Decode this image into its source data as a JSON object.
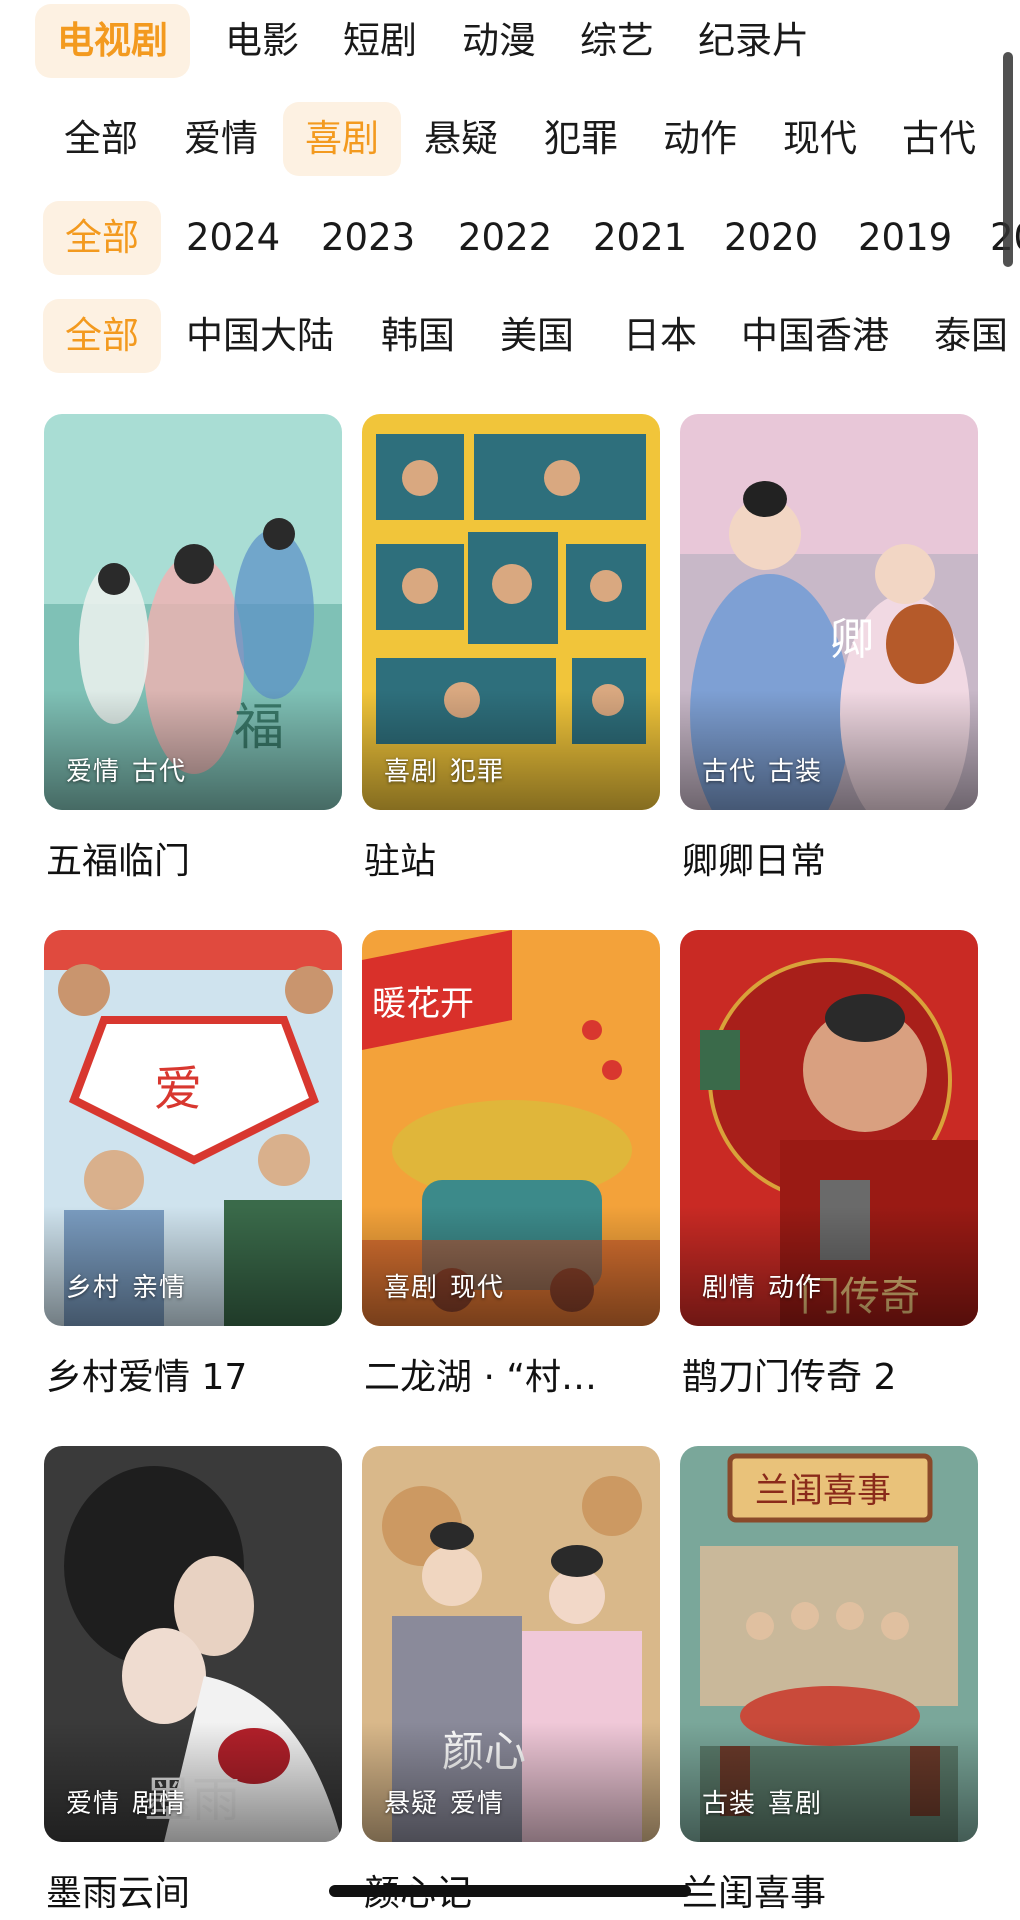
{
  "tabs": [
    "电视剧",
    "电影",
    "短剧",
    "动漫",
    "综艺",
    "纪录片"
  ],
  "genres": [
    "全部",
    "爱情",
    "喜剧",
    "悬疑",
    "犯罪",
    "动作",
    "现代",
    "古代"
  ],
  "years": [
    "全部",
    "2024",
    "2023",
    "2022",
    "2021",
    "2020",
    "2019",
    "20"
  ],
  "regions": [
    "全部",
    "中国大陆",
    "韩国",
    "美国",
    "日本",
    "中国香港",
    "泰国"
  ],
  "selected": {
    "tab": "电视剧",
    "genre": "喜剧",
    "year": "全部",
    "region": "全部"
  },
  "colors": {
    "accent": "#f39a1f",
    "chip_bg": "#fdf1e2"
  },
  "shows": [
    {
      "title": "五福临门",
      "tags": [
        "爱情",
        "古代"
      ],
      "palette": [
        "#a9ddd4",
        "#5fa99c"
      ]
    },
    {
      "title": "驻站",
      "tags": [
        "喜剧",
        "犯罪"
      ],
      "palette": [
        "#f1c53a",
        "#2e6f7c"
      ]
    },
    {
      "title": "卿卿日常",
      "tags": [
        "古代",
        "古装"
      ],
      "palette": [
        "#e8c7d8",
        "#7ea0d4"
      ]
    },
    {
      "title": "乡村爱情 17",
      "tags": [
        "乡村",
        "亲情"
      ],
      "palette": [
        "#cfe3ee",
        "#d8372f"
      ]
    },
    {
      "title": "二龙湖 · “村…",
      "tags": [
        "喜剧",
        "现代"
      ],
      "palette": [
        "#f3a23a",
        "#3c8a8a"
      ]
    },
    {
      "title": "鹊刀门传奇 2",
      "tags": [
        "剧情",
        "动作"
      ],
      "palette": [
        "#c92a24",
        "#7a1410"
      ]
    },
    {
      "title": "墨雨云间",
      "tags": [
        "爱情",
        "剧情"
      ],
      "palette": [
        "#3a3a3a",
        "#d9d9d9"
      ]
    },
    {
      "title": "颜心记",
      "tags": [
        "悬疑",
        "爱情"
      ],
      "palette": [
        "#d9b88a",
        "#8a8a9a"
      ]
    },
    {
      "title": "兰闺喜事",
      "tags": [
        "古装",
        "喜剧"
      ],
      "palette": [
        "#7aa79a",
        "#c94a3a"
      ]
    }
  ]
}
